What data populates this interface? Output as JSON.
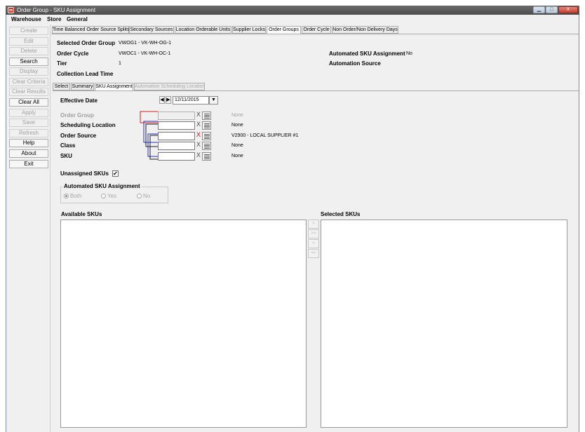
{
  "window": {
    "title": "Order Group - SKU Assignment"
  },
  "menu": [
    "Warehouse",
    "Store",
    "General"
  ],
  "sidebar": [
    {
      "label": "Create",
      "enabled": false
    },
    {
      "label": "Edit",
      "enabled": false
    },
    {
      "label": "Delete",
      "enabled": false
    },
    {
      "label": "Search",
      "enabled": true
    },
    {
      "label": "Display",
      "enabled": false
    },
    {
      "label": "Clear Criteria",
      "enabled": false
    },
    {
      "label": "Clear Results",
      "enabled": false
    },
    {
      "label": "Clear All",
      "enabled": true
    },
    {
      "label": "Apply",
      "enabled": false
    },
    {
      "label": "Save",
      "enabled": false
    },
    {
      "label": "Refresh",
      "enabled": false
    },
    {
      "label": "Help",
      "enabled": true
    },
    {
      "label": "About",
      "enabled": true
    },
    {
      "label": "Exit",
      "enabled": true
    }
  ],
  "top_tabs": [
    {
      "label": "Time Balanced Order Source Splits",
      "active": false
    },
    {
      "label": "Secondary Sources",
      "active": false
    },
    {
      "label": "Location Orderable Units",
      "active": false
    },
    {
      "label": "Supplier Locks",
      "active": false
    },
    {
      "label": "Order Groups",
      "active": true
    },
    {
      "label": "Order Cycle",
      "active": false
    },
    {
      "label": "Non Order/Non Delivery Days",
      "active": false
    }
  ],
  "header": {
    "selected_order_group_label": "Selected Order Group",
    "selected_order_group_value": "VWOG1 - VK-WH-OG-1",
    "order_cycle_label": "Order Cycle",
    "order_cycle_value": "VWOC1 - VK-WH-OC-1",
    "tier_label": "Tier",
    "tier_value": "1",
    "collection_lead_time_label": "Collection Lead Time",
    "automated_sku_assignment_label": "Automated SKU Assignment",
    "automated_sku_assignment_value": "No",
    "automation_source_label": "Automation Source"
  },
  "sub_tabs": [
    {
      "label": "Select",
      "active": false,
      "enabled": true
    },
    {
      "label": "Summary",
      "active": false,
      "enabled": true
    },
    {
      "label": "SKU Assignment",
      "active": true,
      "enabled": true
    },
    {
      "label": "Automation Scheduling Location",
      "active": false,
      "enabled": false
    }
  ],
  "form": {
    "effective_date_label": "Effective Date",
    "effective_date_value": "12/11/2015",
    "rows": [
      {
        "label": "Order Group",
        "enabled": false,
        "value": "None",
        "x_color": "gray"
      },
      {
        "label": "Scheduling Location",
        "enabled": true,
        "value": "None",
        "x_color": "gray"
      },
      {
        "label": "Order Source",
        "enabled": true,
        "value": "V2900 - LOCAL SUPPLIER #1",
        "x_color": "red"
      },
      {
        "label": "Class",
        "enabled": true,
        "value": "None",
        "x_color": "gray"
      },
      {
        "label": "SKU",
        "enabled": true,
        "value": "None",
        "x_color": "gray"
      }
    ],
    "unassigned_skus_label": "Unassigned SKUs",
    "unassigned_skus_checked": true,
    "automated_group_title": "Automated SKU Assignment",
    "automated_options": [
      {
        "label": "Both",
        "selected": true
      },
      {
        "label": "Yes",
        "selected": false
      },
      {
        "label": "No",
        "selected": false
      }
    ]
  },
  "lists": {
    "available_label": "Available SKUs",
    "selected_label": "Selected SKUs",
    "transfer_buttons": [
      ">",
      ">>",
      "<",
      "<<"
    ]
  },
  "icons": {
    "x_glyph": "X",
    "arrow_left": "◀",
    "arrow_right": "▶",
    "dropdown": "▼",
    "check": "✔",
    "minimize": "▁",
    "maximize": "□",
    "close": "X"
  },
  "colors": {
    "connector_red": "#d42020",
    "connector_blue": "#2030c0",
    "connector_black": "#202020"
  }
}
